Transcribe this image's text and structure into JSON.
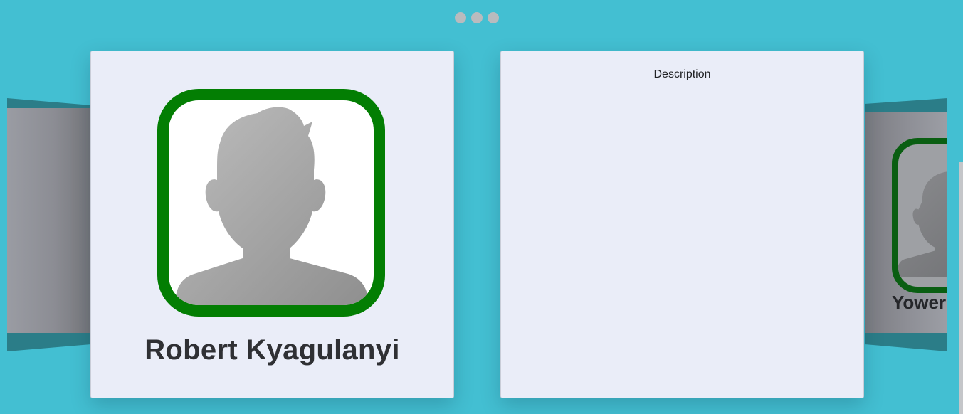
{
  "carousel": {
    "indicator_count": 3
  },
  "left_card": {
    "name": "Robert Kyagulanyi",
    "avatar_icon": "user-placeholder-icon",
    "frame_color": "#037e03"
  },
  "right_card": {
    "title": "Description"
  },
  "next_card": {
    "name_partial": "Yower",
    "frame_color": "#0a5e12"
  },
  "colors": {
    "background": "#43bfd2",
    "card_background": "#eaedf8"
  }
}
